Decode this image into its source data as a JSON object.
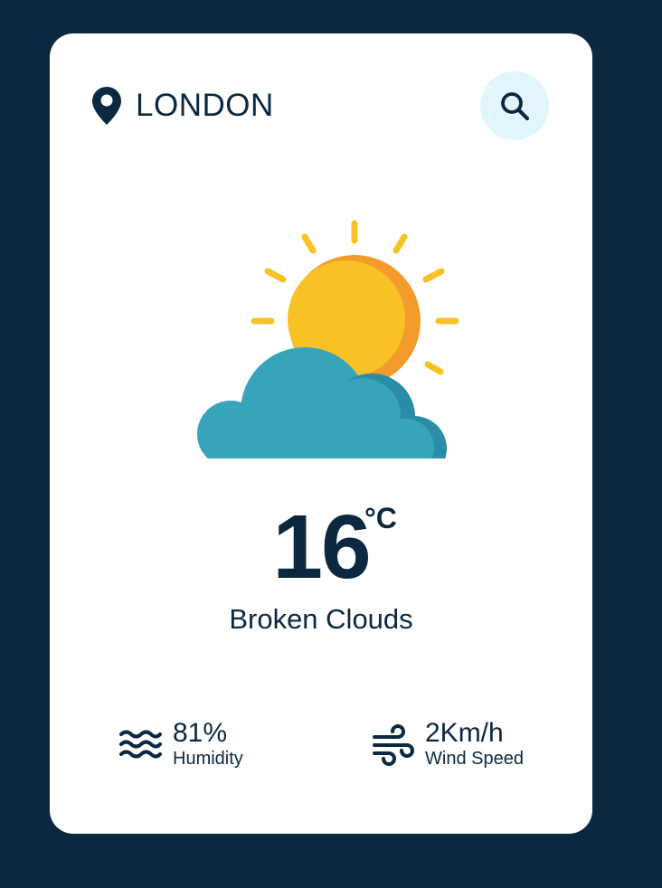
{
  "location": {
    "city": "LONDON",
    "icon": "map-pin-icon"
  },
  "search": {
    "icon": "search-icon"
  },
  "weather": {
    "icon": "sun-behind-cloud-icon",
    "temperature": "16",
    "unit": "°C",
    "condition": "Broken Clouds"
  },
  "stats": {
    "humidity": {
      "icon": "humidity-waves-icon",
      "value": "81%",
      "label": "Humidity"
    },
    "wind": {
      "icon": "wind-icon",
      "value": "2Km/h",
      "label": "Wind Speed"
    }
  },
  "colors": {
    "background": "#0b2840",
    "card": "#ffffff",
    "text": "#0b2840",
    "search_button_bg": "#e2f5fd",
    "sun": "#f8c125",
    "sun_shade": "#f39c2c",
    "cloud": "#38a4bb",
    "cloud_shade": "#2a8ca6"
  }
}
